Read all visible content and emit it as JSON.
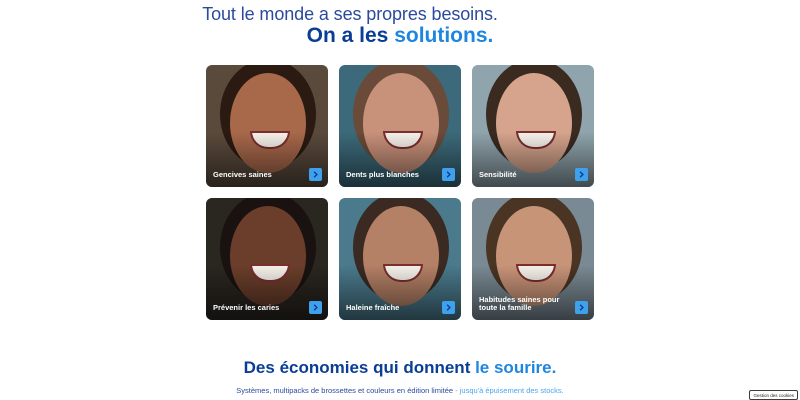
{
  "header": {
    "subtitle": "Tout le monde a ses propres besoins.",
    "title_part1": "On a les ",
    "title_part2": "solutions."
  },
  "cards": [
    {
      "label": "Gencives saines",
      "skin": "#a8684a",
      "bg": "#5a4a3c",
      "hair": "#2a1a12"
    },
    {
      "label": "Dents plus blanches",
      "skin": "#c8917a",
      "bg": "#3c6a7a",
      "hair": "#6a4a38"
    },
    {
      "label": "Sensibilité",
      "skin": "#d6a48c",
      "bg": "#8fa4ac",
      "hair": "#3a2a20"
    },
    {
      "label": "Prévenir les caries",
      "skin": "#6a3e2a",
      "bg": "#2a2620",
      "hair": "#1a1210"
    },
    {
      "label": "Haleine fraîche",
      "skin": "#b48066",
      "bg": "#4a7a8c",
      "hair": "#3a2a22"
    },
    {
      "label": "Habitudes saines pour toute la famille",
      "skin": "#c89478",
      "bg": "#7a8a94",
      "hair": "#4a3424"
    }
  ],
  "savings": {
    "title_part1": "Des économies qui donnent ",
    "title_part2": "le sourire.",
    "subtitle_part1": "Systèmes, multipacks de brossettes et couleurs en édition limitée",
    "subtitle_part2": " - jusqu'à épuisement des stocks."
  },
  "cookie_button": "Gestion des cookies",
  "colors": {
    "brand_dark": "#0a3e96",
    "brand_light": "#1f86e0",
    "arrow_bg": "#3fa0ec"
  }
}
